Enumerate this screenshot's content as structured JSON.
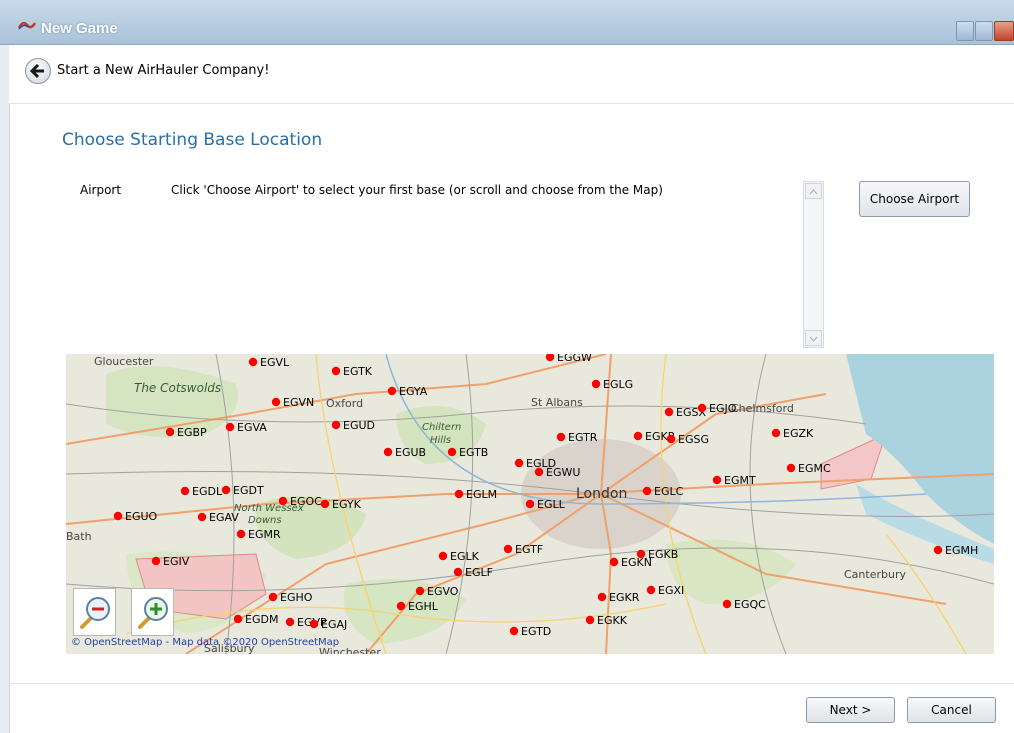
{
  "window": {
    "title": "New Game",
    "title_color": "#ffffff",
    "titlebar_color": "#b5cbe0"
  },
  "header": {
    "title": "Start a New AirHauler Company!"
  },
  "section": {
    "title": "Choose Starting Base Location",
    "title_color": "#2a6ea6"
  },
  "airport": {
    "label": "Airport",
    "instructions": "Click 'Choose Airport' to select your first base (or scroll and choose from the Map)"
  },
  "buttons": {
    "choose_airport": "Choose Airport",
    "next": "Next >",
    "cancel": "Cancel"
  },
  "map": {
    "attribution": "© OpenStreetMap - Map data ©2020 OpenStreetMap",
    "marker_color": "#ff0000",
    "places": [
      "Gloucester",
      "The Cotswolds",
      "Oxford",
      "Chiltern",
      "Hills",
      "St Albans",
      "London",
      "North Wessex",
      "Downs",
      "Bath",
      "Canterbury",
      "Salisbury",
      "Winchester",
      "Chelmsford"
    ],
    "airports": [
      "EGVL",
      "EGTK",
      "EGGW",
      "EGLG",
      "EGYA",
      "EGVN",
      "EGSX",
      "EGJO",
      "EGBP",
      "EGVA",
      "EGUD",
      "EGTR",
      "EGKR",
      "EGSG",
      "EGZK",
      "EGUB",
      "EGTB",
      "EGLD",
      "EGWU",
      "EGMC",
      "EGDL",
      "EGDT",
      "EGLM",
      "EGLC",
      "EGMT",
      "EGOC",
      "EGYK",
      "EGUO",
      "EGAV",
      "EGLL",
      "EGMR",
      "EGIV",
      "EGLK",
      "EGTF",
      "EGKN",
      "EGKB",
      "EGMH",
      "EGLF",
      "EGVO",
      "EGHO",
      "EGHL",
      "EGKR",
      "EGXI",
      "EGQC",
      "EGDM",
      "EGVP",
      "EGAJ",
      "EGKK",
      "EGTD"
    ]
  },
  "icons": {
    "app": "airhauler-logo-icon",
    "back": "back-arrow-icon",
    "zoom_out": "zoom-out-icon",
    "zoom_in": "zoom-in-icon"
  }
}
